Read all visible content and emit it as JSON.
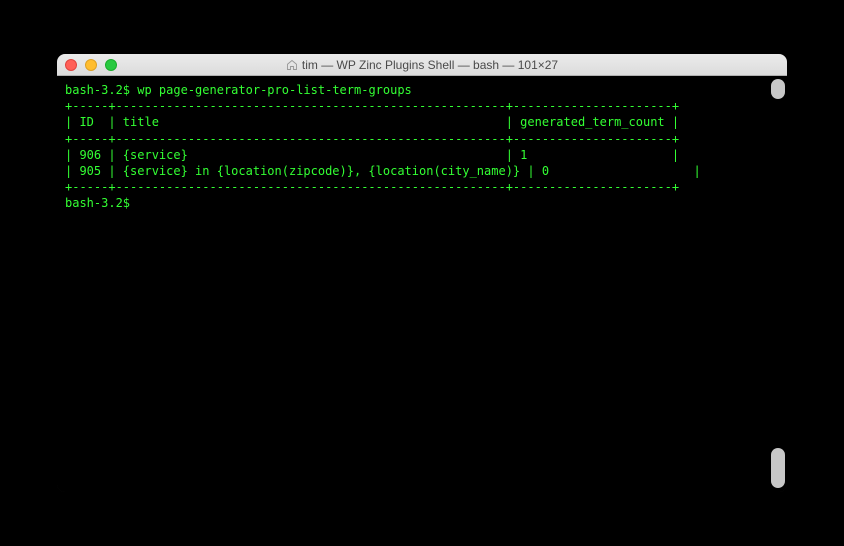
{
  "window": {
    "title": "tim — WP Zinc Plugins Shell — bash — 101×27"
  },
  "terminal": {
    "prompt1": "bash-3.2$ ",
    "command1": "wp page-generator-pro-list-term-groups",
    "divider": "+-----+------------------------------------------------------+----------------------+",
    "header": "| ID  | title                                                | generated_term_count |",
    "row1": "| 906 | {service}                                            | 1                    |",
    "row2": "| 905 | {service} in {location(zipcode)}, {location(city_name)} | 0                    |",
    "prompt2": "bash-3.2$ "
  }
}
